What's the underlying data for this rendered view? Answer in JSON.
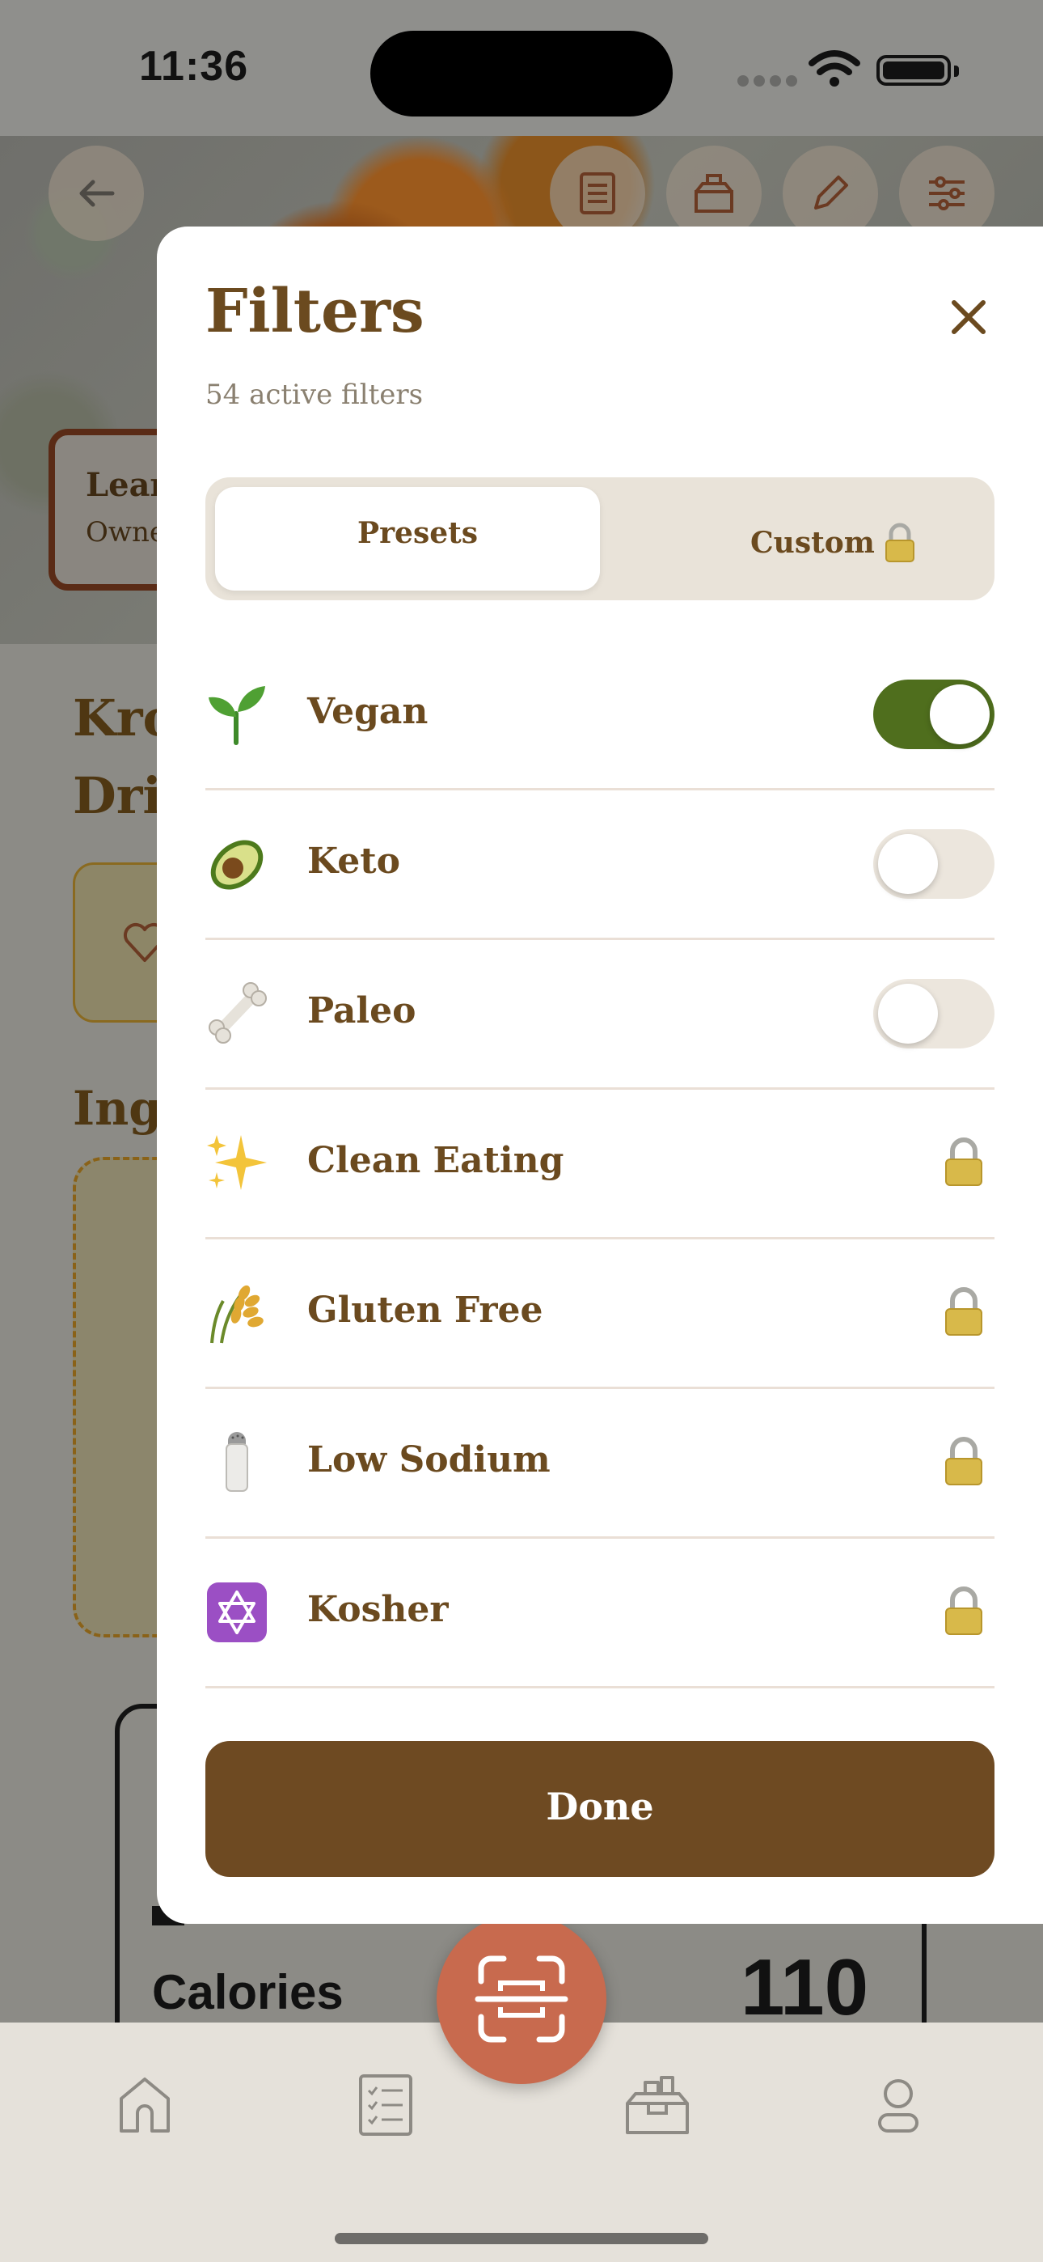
{
  "status_bar": {
    "time": "11:36",
    "icons": [
      "cellular-icon",
      "wifi-icon",
      "battery-icon"
    ]
  },
  "background_page": {
    "hero_badge": {
      "line1": "Lear",
      "line2": "Owne"
    },
    "title_lines": [
      "Kro",
      "Dri"
    ],
    "ingredients_heading": "Ingr",
    "nutrition": {
      "calories_label": "Calories",
      "calories_value": "110"
    },
    "header_buttons": [
      "back-icon",
      "list-icon",
      "pantry-icon",
      "edit-icon",
      "sliders-icon"
    ]
  },
  "filters_sheet": {
    "title": "Filters",
    "subtitle": "54 active filters",
    "tabs": {
      "presets": "Presets",
      "custom": "Custom",
      "selected": "Presets"
    },
    "items": [
      {
        "label": "Vegan",
        "icon": "seedling-icon",
        "control": "toggle",
        "on": true
      },
      {
        "label": "Keto",
        "icon": "avocado-icon",
        "control": "toggle",
        "on": false
      },
      {
        "label": "Paleo",
        "icon": "bone-icon",
        "control": "toggle",
        "on": false
      },
      {
        "label": "Clean Eating",
        "icon": "sparkles-icon",
        "control": "locked"
      },
      {
        "label": "Gluten Free",
        "icon": "wheat-icon",
        "control": "locked"
      },
      {
        "label": "Low Sodium",
        "icon": "salt-shaker-icon",
        "control": "locked"
      },
      {
        "label": "Kosher",
        "icon": "star-of-david-icon",
        "control": "locked"
      }
    ],
    "done_label": "Done"
  },
  "tab_bar": {
    "tabs": [
      "home-icon",
      "recipe-list-icon",
      "scan-icon",
      "pantry-icon",
      "profile-icon"
    ]
  },
  "colors": {
    "brand_brown": "#6e4a22",
    "toggle_on": "#4f6e1d",
    "scan_accent": "#c86a4e",
    "tab_bar_bg": "#e5e1da"
  }
}
